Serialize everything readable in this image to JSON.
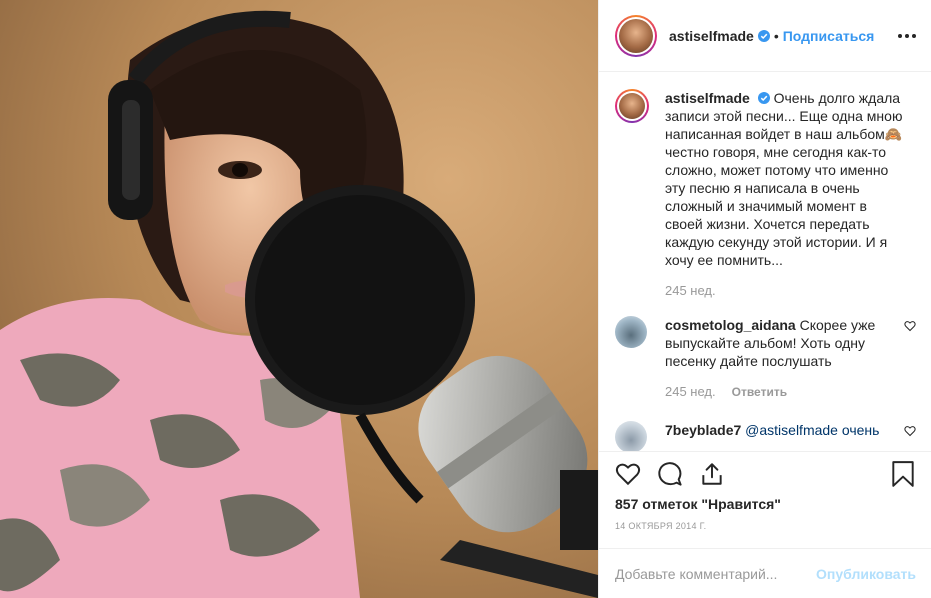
{
  "post": {
    "username": "astiselfmade",
    "follow_label": "Подписаться",
    "more_icon": "more-options-icon",
    "verified_color": "#3897f0"
  },
  "caption": {
    "username": "astiselfmade",
    "text": "Очень долго ждала записи этой песни... Еще одна мною написанная войдет в наш альбом🙈 честно говоря, мне сегодня как-то сложно, может потому что именно эту песню я написала в очень сложный и значимый момент в своей жизни. Хочется передать каждую секунду этой истории. И я хочу ее помнить...",
    "time": "245 нед."
  },
  "comments": [
    {
      "username": "cosmetolog_aidana",
      "text": "Скорее уже выпускайте альбом! Хоть одну песенку дайте послушать",
      "time": "245 нед.",
      "reply_label": "Ответить"
    },
    {
      "username": "7beyblade7",
      "text": "@astiselfmade очень",
      "time": "",
      "reply_label": ""
    }
  ],
  "actions": {
    "like_icon": "heart-icon",
    "comment_icon": "comment-icon",
    "share_icon": "share-icon",
    "save_icon": "bookmark-icon",
    "likes_text": "857 отметок \"Нравится\"",
    "date": "14 ОКТЯБРЯ 2014 Г."
  },
  "add_comment": {
    "placeholder": "Добавьте комментарий...",
    "publish_label": "Опубликовать"
  },
  "colors": {
    "accent": "#3897f0",
    "muted": "#999999",
    "publish_disabled": "#b2dffc"
  }
}
